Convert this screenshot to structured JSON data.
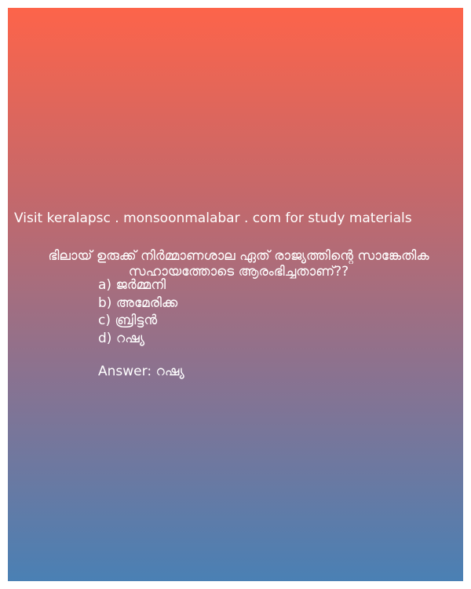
{
  "colors": {
    "gradient_top": "#fd644a",
    "gradient_bottom": "#4a80b4",
    "text": "#ffffff"
  },
  "visit_text": "Visit keralapsc . monsoonmalabar . com for study materials",
  "question": "ഭിലായ് ഉരുക്ക് നിർമ്മാണശാല ഏത് രാജ്യത്തിന്റെ സാങ്കേതിക സഹായത്തോടെ ആരംഭിച്ചതാണ്??",
  "options": [
    "a) ജർമ്മനി",
    "b) അമേരിക്ക",
    "c) ബ്രിട്ടൻ",
    "d) റഷ്യ"
  ],
  "answer": "Answer: റഷ്യ"
}
